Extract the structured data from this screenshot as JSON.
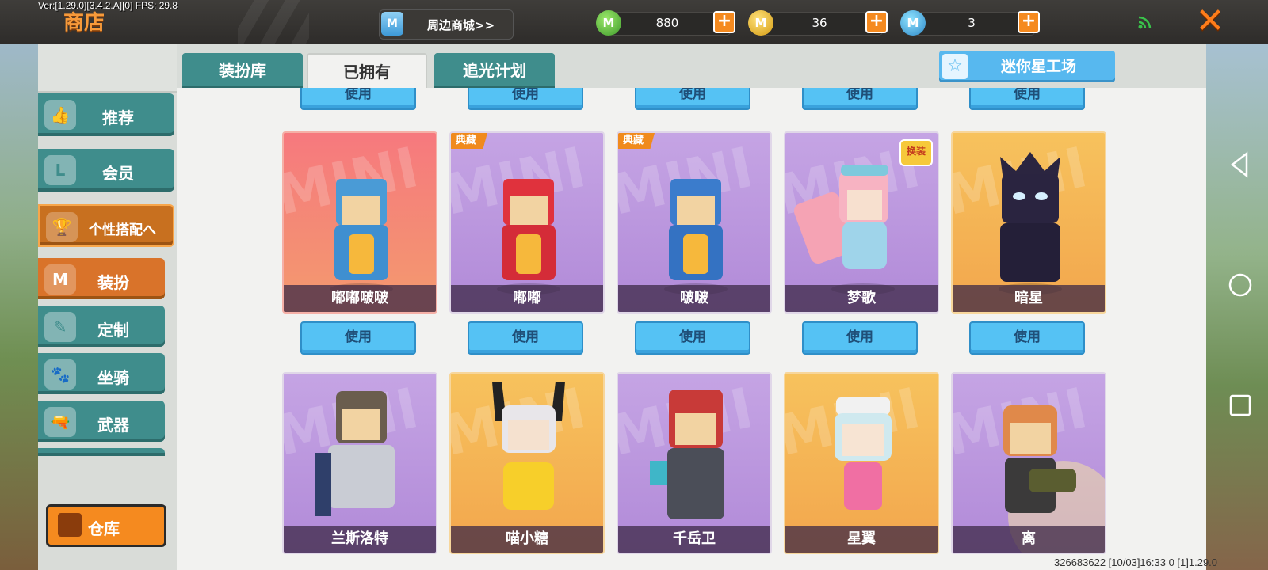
{
  "debug": {
    "version": "Ver:[1.29.0][3.4.2.A][0] FPS: 29.8"
  },
  "header": {
    "title": "商店",
    "mall_label": "周边商城>>",
    "mall_icon": "M",
    "currencies": [
      {
        "icon": "green-coin",
        "glyph": "M",
        "value": "880",
        "color": "#4aa836"
      },
      {
        "icon": "gold-coin",
        "glyph": "M",
        "value": "36",
        "color": "#e0a51a"
      },
      {
        "icon": "blue-coin",
        "glyph": "M",
        "value": "3",
        "color": "#3a9ad8"
      }
    ],
    "plus_glyph": "+",
    "close_glyph": "✕"
  },
  "sidebar": {
    "items": [
      {
        "label": "推荐",
        "icon": "thumbs-up-icon"
      },
      {
        "label": "会员",
        "icon": "member-icon"
      },
      {
        "label": "个性搭配",
        "icon": "trophy-icon",
        "expanded": true
      },
      {
        "label": "装扮",
        "icon": "outfit-icon",
        "active": true
      },
      {
        "label": "定制",
        "icon": "pencil-icon"
      },
      {
        "label": "坐骑",
        "icon": "mount-icon"
      },
      {
        "label": "武器",
        "icon": "gun-icon"
      }
    ],
    "expand_glyph": "へ",
    "warehouse_label": "仓库"
  },
  "tabs": [
    {
      "label": "装扮库",
      "active": false
    },
    {
      "label": "已拥有",
      "active": true
    },
    {
      "label": "追光计划",
      "active": false
    }
  ],
  "star_factory": {
    "label": "迷你星工场",
    "icon": "star-icon"
  },
  "use_label": "使用",
  "watermark": "MINI",
  "cards_row1": [
    {
      "name": "嘟嘟啵啵",
      "theme": "red",
      "badge": ""
    },
    {
      "name": "嘟嘟",
      "theme": "purple",
      "badge": "典藏"
    },
    {
      "name": "啵啵",
      "theme": "purple",
      "badge": "典藏"
    },
    {
      "name": "梦歌",
      "theme": "purple",
      "badge": "",
      "tag": "换装"
    },
    {
      "name": "暗星",
      "theme": "orange",
      "badge": ""
    }
  ],
  "cards_row2": [
    {
      "name": "兰斯洛特",
      "theme": "purple"
    },
    {
      "name": "喵小糖",
      "theme": "orange"
    },
    {
      "name": "千岳卫",
      "theme": "purple"
    },
    {
      "name": "星翼",
      "theme": "orange"
    },
    {
      "name": "离",
      "theme": "purple"
    }
  ],
  "footer": "326683622   [10/03]16:33 0   [1]1.29.0"
}
